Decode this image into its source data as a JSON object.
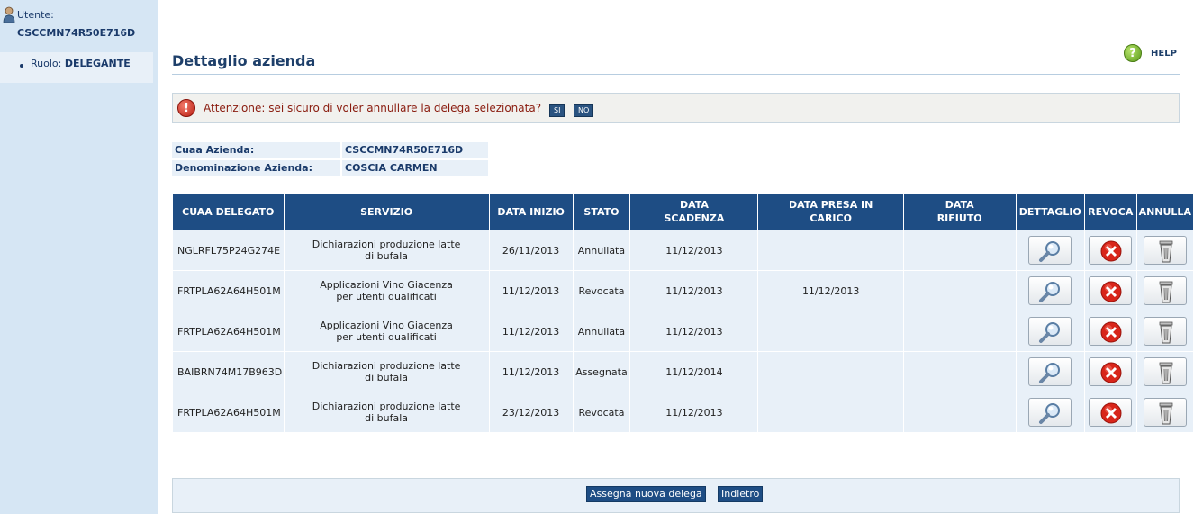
{
  "sidebar": {
    "user_label": "Utente:",
    "user_code": "CSCCMN74R50E716D",
    "role_label": "Ruolo:",
    "role_value": "DELEGANTE"
  },
  "header": {
    "title": "Dettaglio azienda",
    "help_label": "HELP"
  },
  "warning": {
    "message": "Attenzione: sei sicuro di voler annullare la delega selezionata?",
    "yes_label": "SI",
    "no_label": "NO"
  },
  "company": {
    "cuaa_label": "Cuaa Azienda:",
    "cuaa_value": "CSCCMN74R50E716D",
    "name_label": "Denominazione Azienda:",
    "name_value": "COSCIA CARMEN"
  },
  "table": {
    "headers": [
      "CUAA DELEGATO",
      "SERVIZIO",
      "DATA INIZIO",
      "STATO",
      "DATA SCADENZA",
      "DATA PRESA IN CARICO",
      "DATA RIFIUTO",
      "DETTAGLIO",
      "REVOCA",
      "ANNULLA"
    ],
    "rows": [
      {
        "cuaa": "NGLRFL75P24G274E",
        "servizio": "Dichiarazioni produzione latte di bufala",
        "inizio": "26/11/2013",
        "stato": "Annullata",
        "scadenza": "11/12/2013",
        "presa": "",
        "rifiuto": ""
      },
      {
        "cuaa": "FRTPLA62A64H501M",
        "servizio": "Applicazioni Vino Giacenza per utenti qualificati",
        "inizio": "11/12/2013",
        "stato": "Revocata",
        "scadenza": "11/12/2013",
        "presa": "11/12/2013",
        "rifiuto": ""
      },
      {
        "cuaa": "FRTPLA62A64H501M",
        "servizio": "Applicazioni Vino Giacenza per utenti qualificati",
        "inizio": "11/12/2013",
        "stato": "Annullata",
        "scadenza": "11/12/2013",
        "presa": "",
        "rifiuto": ""
      },
      {
        "cuaa": "BAIBRN74M17B963D",
        "servizio": "Dichiarazioni produzione latte di bufala",
        "inizio": "11/12/2013",
        "stato": "Assegnata",
        "scadenza": "11/12/2014",
        "presa": "",
        "rifiuto": ""
      },
      {
        "cuaa": "FRTPLA62A64H501M",
        "servizio": "Dichiarazioni produzione latte di bufala",
        "inizio": "23/12/2013",
        "stato": "Revocata",
        "scadenza": "11/12/2013",
        "presa": "",
        "rifiuto": ""
      }
    ]
  },
  "icons": {
    "detail": "magnifier-icon",
    "revoke": "red-x-icon",
    "cancel": "trash-icon",
    "help": "question-icon",
    "warning": "exclamation-icon",
    "user": "user-icon"
  },
  "footer": {
    "assign_label": "Assegna nuova delega",
    "back_label": "Indietro"
  },
  "colors": {
    "sidebar": "#d6e6f4",
    "header_bg": "#1e4d84",
    "cell_bg": "#e8f0f8",
    "warning_text": "#8a1c0f"
  }
}
